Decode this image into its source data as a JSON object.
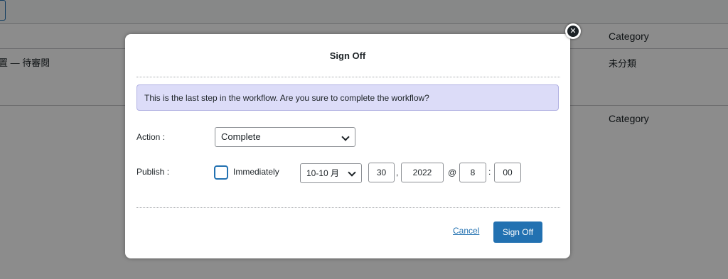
{
  "background": {
    "row1_text": "置 — 待審閱",
    "header_category": "Category",
    "row1_category": "未分類",
    "footer_category": "Category"
  },
  "modal": {
    "title": "Sign Off",
    "close_icon": "close-icon",
    "notice": "This is the last step in the workflow. Are you sure to complete the workflow?",
    "action_label": "Action :",
    "action_value": "Complete",
    "publish_label": "Publish :",
    "immediately_label": "Immediately",
    "immediately_checked": false,
    "month": "10-10 月",
    "day": "30",
    "year": "2022",
    "at_sign": "@",
    "hour": "8",
    "time_sep": ":",
    "minute": "00",
    "date_comma": ",",
    "cancel_label": "Cancel",
    "submit_label": "Sign Off"
  },
  "colors": {
    "accent": "#2271b1",
    "notice_bg": "#dcdcf8"
  }
}
